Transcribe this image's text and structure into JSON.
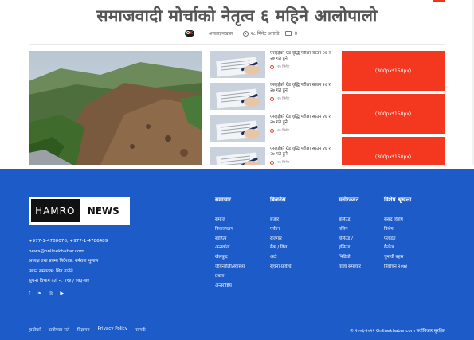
{
  "article": {
    "headline": "समाजवादी मोर्चाको नेतृत्व ६ महिने आलोपालो",
    "author": "अनलाइनखबर",
    "time": "२८ मिनेट अगाडि",
    "comments": "0"
  },
  "related": [
    {
      "title": "एसइईको ग्रेड वृद्धि परीक्षा साउन २६ र २७ गते हुने",
      "time": "२७ मिनेट"
    },
    {
      "title": "एसइईको ग्रेड वृद्धि परीक्षा साउन २६ र २७ गते हुने",
      "time": "२७ मिनेट"
    },
    {
      "title": "एसइईको ग्रेड वृद्धि परीक्षा साउन २६ र २७ गते हुने",
      "time": "२७ मिनेट"
    },
    {
      "title": "एसइईको ग्रेड वृद्धि परीक्षा साउन २६ र २७ गते हुने",
      "time": "२७ मिनेट"
    }
  ],
  "ads": [
    "(300px*150px)",
    "(300px*150px)",
    "(300px*150px)"
  ],
  "footer": {
    "brand_left": "HAMRO",
    "brand_right": "NEWS",
    "contact": [
      "+977-1-4780076, +977-1-4786489",
      "news@onlinekhabar.com",
      "अध्यक्ष तथा प्रबन्ध निर्देशक: धर्मराज भुसाल",
      "प्रधान सम्पादक: शिव गाउँले",
      "सूचना विभाग दर्ता नं. २१४ / ०७३–७४"
    ],
    "social": [
      "f",
      "t",
      "in",
      "yt"
    ],
    "columns": [
      {
        "head": "समाचार",
        "links": [
          "समाज",
          "विचार/ब्लग",
          "साहित्य",
          "अन्तर्वार्ता",
          "खेलकुद",
          "जीवनशैली/स्वास्थ्य",
          "प्रवास",
          "अन्तर्राष्ट्रिय"
        ]
      },
      {
        "head": "बिजनेस",
        "links": [
          "बजार",
          "पर्यटन",
          "रोजगार",
          "बैंक / वित्त",
          "अटो",
          "सूचना-प्रविधि"
        ]
      },
      {
        "head": "मनोरञ्जन",
        "links": [
          "बलिउड",
          "गसिप",
          "हलिउड /",
          "हलिउड",
          "भिडियो",
          "ताजा समाचार"
        ]
      },
      {
        "head": "विशेष श्रृंखला",
        "links": [
          "संसद विशेष",
          "विशेष",
          "फ्लाइङ",
          "कैलेज",
          "चुनावी बहस",
          "निर्वाचन २०७४"
        ]
      }
    ],
    "bottom_links": [
      "हाम्रोबारे",
      "प्रयोगका सर्त",
      "विज्ञापन",
      "Privacy Policy",
      "सम्पर्क"
    ],
    "copyright": "© २००६-२०२२ Onlinekhabar.com सर्वाधिकार सुरक्षित"
  }
}
